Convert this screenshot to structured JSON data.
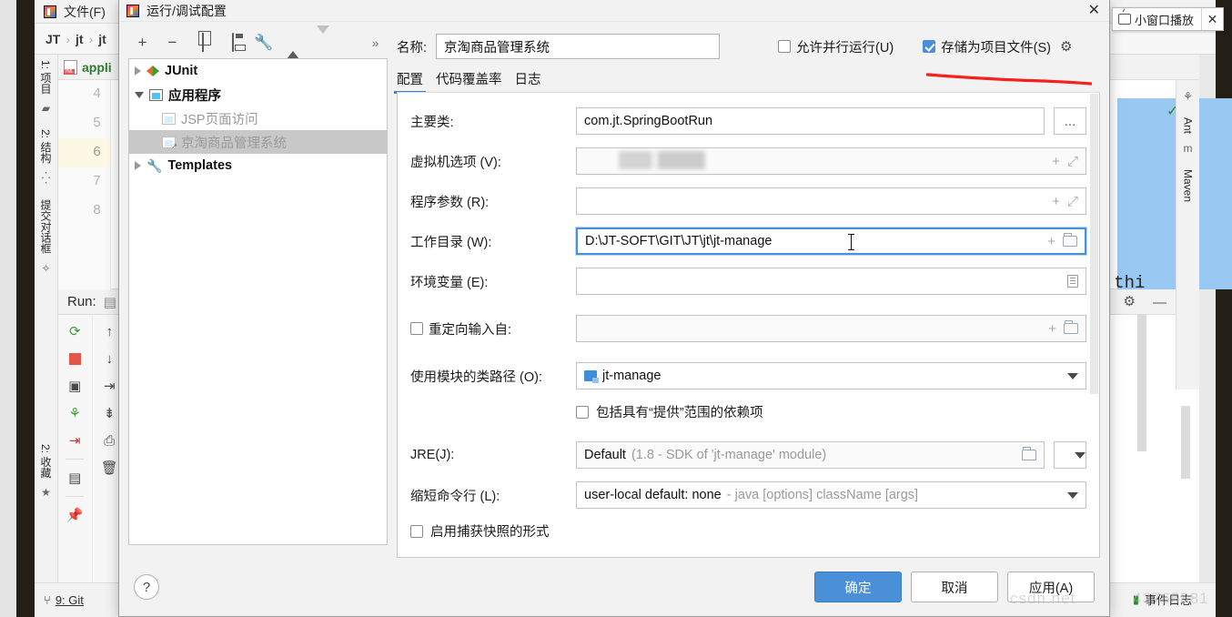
{
  "ide": {
    "menu": {
      "file": "文件(F)"
    },
    "breadcrumb": {
      "part1": "JT",
      "part2": "jt",
      "part3": "jt",
      "sep": "›"
    },
    "left_tool_window_labels": [
      "1: 项目",
      "2: 结构",
      "提交对话框"
    ],
    "left_bottom_label": "2: 收藏",
    "editor_tab": {
      "name": "appli",
      "icon": "yml-file-icon"
    },
    "gutter_lines": [
      "4",
      "5",
      "6",
      "7",
      "8"
    ],
    "highlighted_line": "6",
    "code_fragment": "or thi",
    "run_window": {
      "title": "Run:"
    },
    "right_tool_tabs": [
      "Ant",
      "Maven"
    ],
    "status_bar": {
      "git": "9: Git",
      "git_number": "9",
      "event_log": "事件日志"
    },
    "watermark_left": "csdn.net",
    "watermark_right": "43765881"
  },
  "mini_popup": {
    "label": "小窗口播放",
    "close": "✕",
    "icon": "tv-icon"
  },
  "dialog": {
    "title": "运行/调试配置",
    "close": "✕",
    "tree_toolbar": {
      "add": "+",
      "remove": "−",
      "copy": "copy-icon",
      "save": "save-icon",
      "edit_templates": "wrench-icon",
      "move_up": "arrow-up-icon",
      "move_down": "arrow-down-icon",
      "more": "»"
    },
    "tree": [
      {
        "label": "JUnit",
        "icon": "junit-icon",
        "bold": true,
        "expandable": true,
        "expanded": false,
        "selected": false,
        "level": 0
      },
      {
        "label": "应用程序",
        "icon": "application-icon",
        "bold": true,
        "expandable": true,
        "expanded": true,
        "selected": false,
        "level": 0
      },
      {
        "label": "JSP页面访问",
        "icon": "application-icon",
        "bold": false,
        "expandable": false,
        "expanded": false,
        "selected": false,
        "level": 1
      },
      {
        "label": "京淘商品管理系统",
        "icon": "application-icon",
        "bold": false,
        "expandable": false,
        "expanded": false,
        "selected": true,
        "level": 1
      },
      {
        "label": "Templates",
        "icon": "wrench-icon",
        "bold": true,
        "expandable": true,
        "expanded": false,
        "selected": false,
        "level": 0
      }
    ],
    "name": {
      "label": "名称:",
      "value": "京淘商品管理系统"
    },
    "allow_parallel": {
      "label": "允许并行运行(U)",
      "checked": false
    },
    "store_as_project_file": {
      "label": "存储为项目文件(S)",
      "checked": true
    },
    "gear": "gear-icon",
    "tabs": [
      {
        "label": "配置",
        "active": true
      },
      {
        "label": "代码覆盖率",
        "active": false
      },
      {
        "label": "日志",
        "active": false
      }
    ],
    "fields": {
      "main_class": {
        "label": "主要类:",
        "value": "com.jt.SpringBootRun",
        "browse": "..."
      },
      "vm_options": {
        "label": "虚拟机选项 (V):",
        "value": "",
        "censored": true,
        "icons": [
          "plus-icon",
          "expand-icon"
        ]
      },
      "program_args": {
        "label": "程序参数 (R):",
        "value": "",
        "icons": [
          "plus-icon",
          "expand-icon"
        ]
      },
      "working_dir": {
        "label": "工作目录 (W):",
        "value": "D:\\JT-SOFT\\GIT\\JT\\jt\\jt-manage",
        "focused": true,
        "icons": [
          "plus-icon",
          "folder-icon"
        ]
      },
      "env_vars": {
        "label": "环境变量 (E):",
        "value": "",
        "icons": [
          "env-list-icon"
        ]
      },
      "redirect_input": {
        "label": "重定向输入自:",
        "checked": false,
        "value": "",
        "icons": [
          "plus-icon",
          "folder-icon"
        ]
      },
      "module_classpath": {
        "label": "使用模块的类路径 (O):",
        "value": "jt-manage",
        "icon": "module-icon"
      },
      "include_provided": {
        "label": "包括具有“提供”范围的依赖项",
        "checked": false
      },
      "jre": {
        "label": "JRE(J):",
        "value": "Default",
        "hint": "(1.8 - SDK of 'jt-manage' module)"
      },
      "shorten_cmdline": {
        "label": "缩短命令行 (L):",
        "value": "user-local default: none",
        "hint": "- java [options] className [args]"
      },
      "enable_snapshot": {
        "label": "启用捕获快照的形式",
        "checked": false
      }
    },
    "footer": {
      "help": "?",
      "ok": "确定",
      "cancel": "取消",
      "apply": "应用(A)"
    }
  },
  "colors": {
    "accent_blue": "#4a90d9",
    "tab_underline": "#3d7fd6",
    "annotation_red": "#f52020",
    "selection_blue": "#99c9f2",
    "tree_selection": "#c8c8c8"
  }
}
